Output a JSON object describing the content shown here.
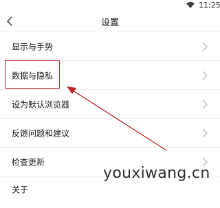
{
  "status_bar": {
    "time": "11:25",
    "icons": [
      "wifi-icon"
    ]
  },
  "header": {
    "title": "设置",
    "back_icon": "chevron-left-icon"
  },
  "settings": {
    "items": [
      {
        "label": "显示与手势"
      },
      {
        "label": "数据与隐私"
      },
      {
        "label": "设为默认浏览器"
      },
      {
        "label": "反馈问题和建议"
      },
      {
        "label": "检查更新"
      },
      {
        "label": "关于"
      }
    ]
  },
  "annotation": {
    "highlight_color": "#c0282a"
  },
  "watermark": "youxiwang.cn"
}
